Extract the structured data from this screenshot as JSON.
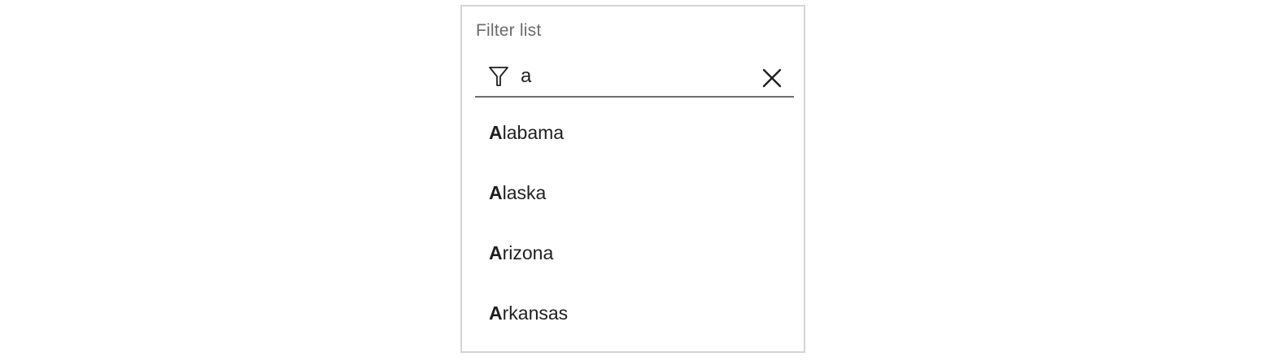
{
  "filter": {
    "label": "Filter list",
    "value": "a",
    "placeholder": ""
  },
  "icons": {
    "filter": "funnel-icon",
    "clear": "close-icon"
  },
  "results": [
    {
      "match": "A",
      "rest": "labama"
    },
    {
      "match": "A",
      "rest": "laska"
    },
    {
      "match": "A",
      "rest": "rizona"
    },
    {
      "match": "A",
      "rest": "rkansas"
    }
  ]
}
